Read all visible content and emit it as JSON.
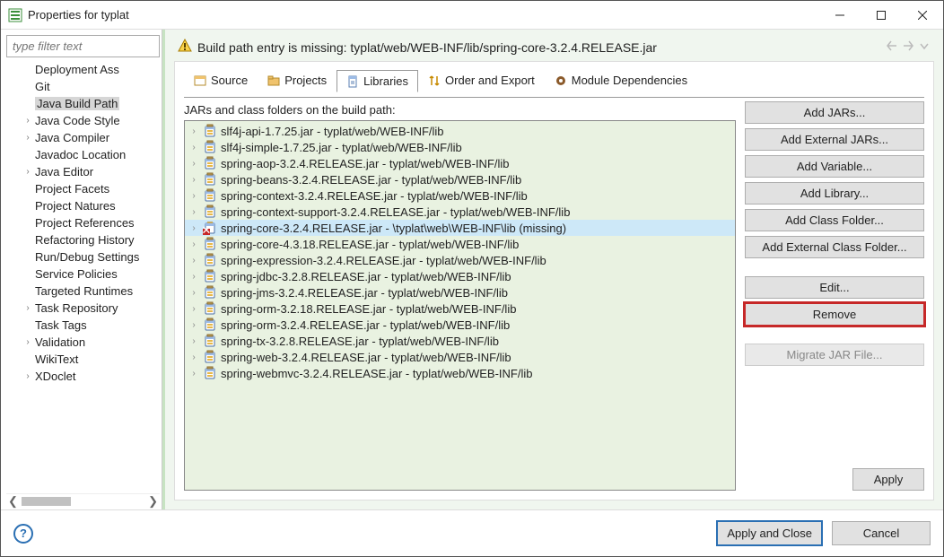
{
  "window": {
    "title": "Properties for typlat"
  },
  "sidebar": {
    "filter_placeholder": "type filter text",
    "items": [
      {
        "label": "Deployment Ass",
        "exp": false
      },
      {
        "label": "Git",
        "exp": false
      },
      {
        "label": "Java Build Path",
        "exp": false,
        "selected": true
      },
      {
        "label": "Java Code Style",
        "exp": true
      },
      {
        "label": "Java Compiler",
        "exp": true
      },
      {
        "label": "Javadoc Location",
        "exp": false
      },
      {
        "label": "Java Editor",
        "exp": true
      },
      {
        "label": "Project Facets",
        "exp": false
      },
      {
        "label": "Project Natures",
        "exp": false
      },
      {
        "label": "Project References",
        "exp": false
      },
      {
        "label": "Refactoring History",
        "exp": false
      },
      {
        "label": "Run/Debug Settings",
        "exp": false
      },
      {
        "label": "Service Policies",
        "exp": false
      },
      {
        "label": "Targeted Runtimes",
        "exp": false
      },
      {
        "label": "Task Repository",
        "exp": true
      },
      {
        "label": "Task Tags",
        "exp": false
      },
      {
        "label": "Validation",
        "exp": true
      },
      {
        "label": "WikiText",
        "exp": false
      },
      {
        "label": "XDoclet",
        "exp": true
      }
    ],
    "scroll_up": "⌃",
    "scroll_left": "❮",
    "scroll_right": "❯"
  },
  "warning": {
    "message": "Build path entry is missing: typlat/web/WEB-INF/lib/spring-core-3.2.4.RELEASE.jar"
  },
  "tabs": [
    {
      "label": "Source",
      "icon": "source-icon"
    },
    {
      "label": "Projects",
      "icon": "projects-icon"
    },
    {
      "label": "Libraries",
      "icon": "libraries-icon",
      "active": true
    },
    {
      "label": "Order and Export",
      "icon": "order-icon"
    },
    {
      "label": "Module Dependencies",
      "icon": "module-icon"
    }
  ],
  "jar_caption": "JARs and class folders on the build path:",
  "jars": [
    {
      "name": "slf4j-api-1.7.25.jar - typlat/web/WEB-INF/lib"
    },
    {
      "name": "slf4j-simple-1.7.25.jar - typlat/web/WEB-INF/lib"
    },
    {
      "name": "spring-aop-3.2.4.RELEASE.jar - typlat/web/WEB-INF/lib"
    },
    {
      "name": "spring-beans-3.2.4.RELEASE.jar - typlat/web/WEB-INF/lib"
    },
    {
      "name": "spring-context-3.2.4.RELEASE.jar - typlat/web/WEB-INF/lib"
    },
    {
      "name": "spring-context-support-3.2.4.RELEASE.jar - typlat/web/WEB-INF/lib"
    },
    {
      "name": "spring-core-3.2.4.RELEASE.jar - \\typlat\\web\\WEB-INF\\lib (missing)",
      "missing": true,
      "selected": true
    },
    {
      "name": "spring-core-4.3.18.RELEASE.jar - typlat/web/WEB-INF/lib"
    },
    {
      "name": "spring-expression-3.2.4.RELEASE.jar - typlat/web/WEB-INF/lib"
    },
    {
      "name": "spring-jdbc-3.2.8.RELEASE.jar - typlat/web/WEB-INF/lib"
    },
    {
      "name": "spring-jms-3.2.4.RELEASE.jar - typlat/web/WEB-INF/lib"
    },
    {
      "name": "spring-orm-3.2.18.RELEASE.jar - typlat/web/WEB-INF/lib"
    },
    {
      "name": "spring-orm-3.2.4.RELEASE.jar - typlat/web/WEB-INF/lib"
    },
    {
      "name": "spring-tx-3.2.8.RELEASE.jar - typlat/web/WEB-INF/lib"
    },
    {
      "name": "spring-web-3.2.4.RELEASE.jar - typlat/web/WEB-INF/lib"
    },
    {
      "name": "spring-webmvc-3.2.4.RELEASE.jar - typlat/web/WEB-INF/lib"
    }
  ],
  "buttons": {
    "add_jars": "Add JARs...",
    "add_ext_jars": "Add External JARs...",
    "add_var": "Add Variable...",
    "add_lib": "Add Library...",
    "add_cf": "Add Class Folder...",
    "add_ext_cf": "Add External Class Folder...",
    "edit": "Edit...",
    "remove": "Remove",
    "migrate": "Migrate JAR File...",
    "apply": "Apply"
  },
  "footer": {
    "apply_close": "Apply and Close",
    "cancel": "Cancel"
  }
}
